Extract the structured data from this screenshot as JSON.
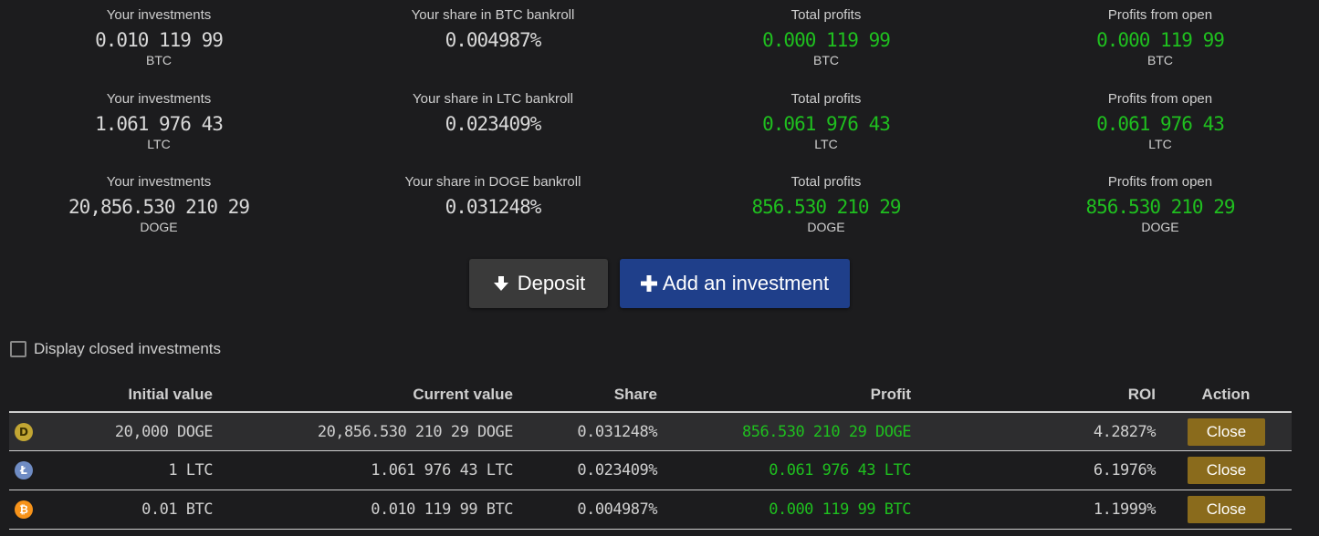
{
  "stats": [
    {
      "investments_label": "Your investments",
      "investments_value": "0.010 119 99",
      "investments_unit": "BTC",
      "share_label": "Your share in BTC bankroll",
      "share_value": "0.004987%",
      "total_profits_label": "Total profits",
      "total_profits_value": "0.000 119 99",
      "total_profits_unit": "BTC",
      "open_profits_label": "Profits from open",
      "open_profits_value": "0.000 119 99",
      "open_profits_unit": "BTC"
    },
    {
      "investments_label": "Your investments",
      "investments_value": "1.061 976 43",
      "investments_unit": "LTC",
      "share_label": "Your share in LTC bankroll",
      "share_value": "0.023409%",
      "total_profits_label": "Total profits",
      "total_profits_value": "0.061 976 43",
      "total_profits_unit": "LTC",
      "open_profits_label": "Profits from open",
      "open_profits_value": "0.061 976 43",
      "open_profits_unit": "LTC"
    },
    {
      "investments_label": "Your investments",
      "investments_value": "20,856.530 210 29",
      "investments_unit": "DOGE",
      "share_label": "Your share in DOGE bankroll",
      "share_value": "0.031248%",
      "total_profits_label": "Total profits",
      "total_profits_value": "856.530 210 29",
      "total_profits_unit": "DOGE",
      "open_profits_label": "Profits from open",
      "open_profits_value": "856.530 210 29",
      "open_profits_unit": "DOGE"
    }
  ],
  "buttons": {
    "deposit_label": "Deposit",
    "invest_label": "Add an investment"
  },
  "filter": {
    "display_closed_label": "Display closed investments",
    "checked": false
  },
  "table": {
    "headers": {
      "initial": "Initial value",
      "current": "Current value",
      "share": "Share",
      "profit": "Profit",
      "roi": "ROI",
      "action": "Action"
    },
    "rows": [
      {
        "coin": "D",
        "initial": "20,000 DOGE",
        "current": "20,856.530 210 29 DOGE",
        "share": "0.031248%",
        "profit": "856.530 210 29 DOGE",
        "roi": "4.2827%",
        "action": "Close"
      },
      {
        "coin": "Ł",
        "initial": "1 LTC",
        "current": "1.061 976 43 LTC",
        "share": "0.023409%",
        "profit": "0.061 976 43 LTC",
        "roi": "6.1976%",
        "action": "Close"
      },
      {
        "coin": "₿",
        "initial": "0.01 BTC",
        "current": "0.010 119 99 BTC",
        "share": "0.004987%",
        "profit": "0.000 119 99 BTC",
        "roi": "1.1999%",
        "action": "Close"
      }
    ]
  },
  "colors": {
    "background": "#1c1c1e",
    "profit_green": "#1fbf1f",
    "deposit_button": "#3a3a3a",
    "invest_button": "#1f3f8a",
    "close_button": "#8a6b1c",
    "doge": "#c2a633",
    "ltc": "#6f8cc4",
    "btc": "#f7931a"
  }
}
